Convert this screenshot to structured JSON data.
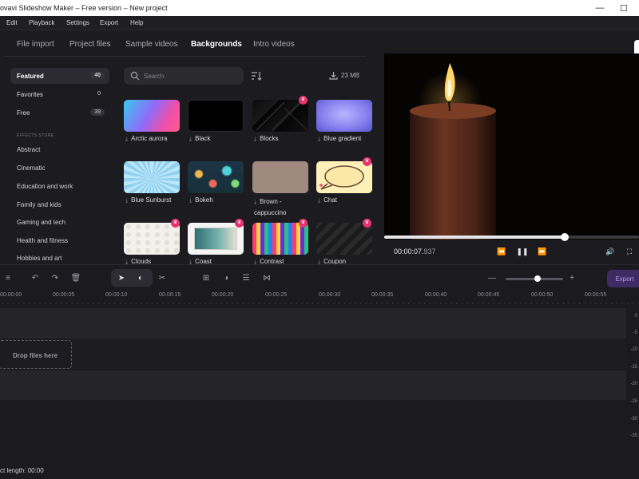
{
  "window": {
    "title": "ovavi Slideshow Maker – Free version – New project"
  },
  "menu": [
    "Edit",
    "Playback",
    "Settings",
    "Export",
    "Help"
  ],
  "tabs": [
    "File import",
    "Project files",
    "Sample videos",
    "Backgrounds",
    "Intro videos"
  ],
  "active_tab": "Backgrounds",
  "sidebar": {
    "categories": [
      {
        "label": "Featured",
        "count": "40"
      },
      {
        "label": "Favorites",
        "count": "0"
      },
      {
        "label": "Free",
        "count": "39"
      }
    ],
    "section_title": "EFFECTS STORE",
    "store_items": [
      "Abstract",
      "Cinematic",
      "Education and work",
      "Family and kids",
      "Gaming and tech",
      "Health and fitness",
      "Hobbies and art"
    ]
  },
  "search": {
    "placeholder": "Search"
  },
  "download_size": "23 MB",
  "tiles": [
    {
      "label": "Arctic aurora",
      "premium": false
    },
    {
      "label": "Black",
      "premium": false
    },
    {
      "label": "Blocks",
      "premium": true
    },
    {
      "label": "Blue gradient",
      "premium": false
    },
    {
      "label": "Blue Sunburst",
      "premium": false
    },
    {
      "label": "Bokeh",
      "premium": false
    },
    {
      "label": "Brown - cappuccino",
      "premium": false
    },
    {
      "label": "Chat",
      "premium": true
    },
    {
      "label": "Clouds",
      "premium": true
    },
    {
      "label": "Coast",
      "premium": true
    },
    {
      "label": "Contrast",
      "premium": true
    },
    {
      "label": "Coupon",
      "premium": true
    }
  ],
  "player": {
    "time_main": "00:00:07.",
    "time_ms": "937",
    "progress": 0.71
  },
  "toolbar": {
    "export_label": "Export",
    "zoom_level": 0.55
  },
  "ruler_ticks": [
    "00:00:00",
    "00:00:05",
    "00:00:10",
    "00:00:15",
    "00:00:20",
    "00:00:25",
    "00:00:30",
    "00:00:35",
    "00:00:40",
    "00:00:45",
    "00:00:50",
    "00:00:55"
  ],
  "timeline": {
    "drop_label": "Drop files here"
  },
  "meter_labels": [
    "0",
    "-5",
    "-10",
    "-15",
    "-20",
    "-25",
    "-30",
    "-35"
  ],
  "status": {
    "project_length": "ct length: 00:00"
  }
}
